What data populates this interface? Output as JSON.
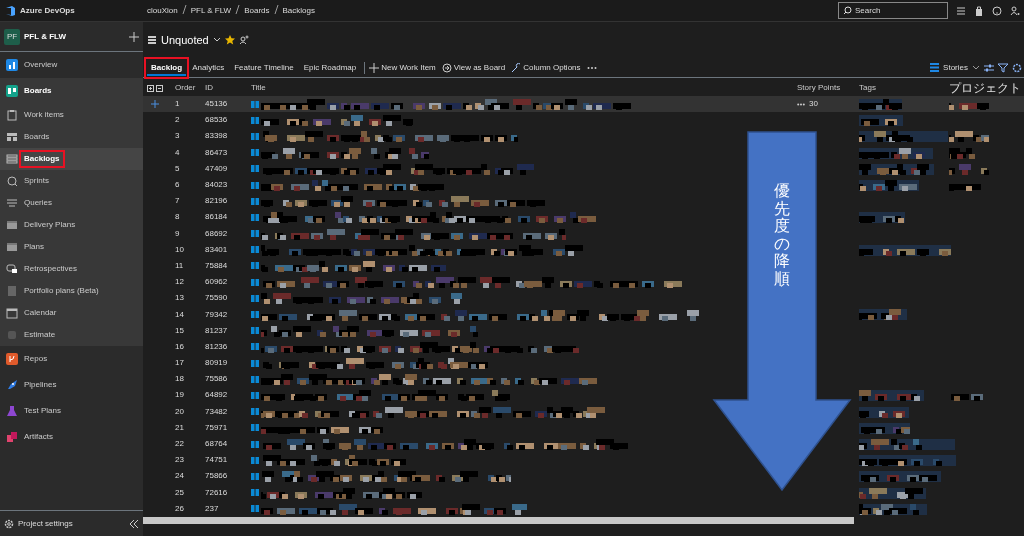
{
  "topbar": {
    "brand": "Azure DevOps",
    "breadcrumbs": [
      "clouXion",
      "PFL & FLW",
      "Boards",
      "Backlogs"
    ],
    "search": {
      "placeholder": "Search"
    }
  },
  "sidebar": {
    "project": {
      "initials": "PF",
      "name": "PFL & FLW"
    },
    "items": [
      {
        "label": "Overview",
        "kind": "section",
        "selected": false,
        "highlighted": false
      },
      {
        "label": "Boards",
        "kind": "section",
        "selected": false,
        "highlighted": false,
        "expanded": true,
        "children": [
          {
            "label": "Work items",
            "kind": "page",
            "selected": false,
            "highlighted": false
          },
          {
            "label": "Boards",
            "kind": "page",
            "selected": false,
            "highlighted": false
          },
          {
            "label": "Backlogs",
            "kind": "page",
            "selected": true,
            "highlighted": true
          },
          {
            "label": "Sprints",
            "kind": "page",
            "selected": false,
            "highlighted": false
          },
          {
            "label": "Queries",
            "kind": "page",
            "selected": false,
            "highlighted": false
          },
          {
            "label": "Delivery Plans",
            "kind": "page",
            "selected": false,
            "highlighted": false
          },
          {
            "label": "Plans",
            "kind": "page",
            "selected": false,
            "highlighted": false
          },
          {
            "label": "Retrospectives",
            "kind": "page",
            "selected": false,
            "highlighted": false
          },
          {
            "label": "Portfolio plans (Beta)",
            "kind": "page",
            "selected": false,
            "highlighted": false
          },
          {
            "label": "Calendar",
            "kind": "page",
            "selected": false,
            "highlighted": false
          },
          {
            "label": "Estimate",
            "kind": "page",
            "selected": false,
            "highlighted": false
          }
        ]
      },
      {
        "label": "Repos",
        "kind": "section",
        "selected": false,
        "highlighted": false
      },
      {
        "label": "Pipelines",
        "kind": "section",
        "selected": false,
        "highlighted": false
      },
      {
        "label": "Test Plans",
        "kind": "section",
        "selected": false,
        "highlighted": false
      },
      {
        "label": "Artifacts",
        "kind": "section",
        "selected": false,
        "highlighted": false
      }
    ],
    "settings": "Project settings"
  },
  "header": {
    "title": "Unquoted"
  },
  "tabs": [
    {
      "label": "Backlog",
      "selected": true,
      "highlighted": true
    },
    {
      "label": "Analytics",
      "selected": false,
      "highlighted": false
    },
    {
      "label": "Feature Timeline",
      "selected": false,
      "highlighted": false
    },
    {
      "label": "Epic Roadmap",
      "selected": false,
      "highlighted": false
    }
  ],
  "actions": [
    {
      "label": "New Work Item"
    },
    {
      "label": "View as Board"
    },
    {
      "label": "Column Options"
    }
  ],
  "level_picker": "Stories",
  "table": {
    "columns": [
      "Order",
      "ID",
      "Title",
      "Story Points",
      "Tags",
      "プロジェクト"
    ],
    "rows": [
      {
        "order": "1",
        "id": "45136",
        "points": "30",
        "selected": true,
        "tags": true,
        "project": true
      },
      {
        "order": "2",
        "id": "68536",
        "selected": false,
        "tags": true,
        "project": false
      },
      {
        "order": "3",
        "id": "83398",
        "selected": false,
        "tags": true,
        "project": true
      },
      {
        "order": "4",
        "id": "86473",
        "selected": false,
        "tags": true,
        "project": true
      },
      {
        "order": "5",
        "id": "47409",
        "selected": false,
        "tags": true,
        "project": true
      },
      {
        "order": "6",
        "id": "84023",
        "selected": false,
        "tags": true,
        "project": true
      },
      {
        "order": "7",
        "id": "82196",
        "selected": false,
        "tags": false,
        "project": false
      },
      {
        "order": "8",
        "id": "86184",
        "selected": false,
        "tags": true,
        "project": false
      },
      {
        "order": "9",
        "id": "68692",
        "selected": false,
        "tags": false,
        "project": false
      },
      {
        "order": "10",
        "id": "83401",
        "selected": false,
        "tags": true,
        "project": false
      },
      {
        "order": "11",
        "id": "75884",
        "selected": false,
        "tags": false,
        "project": false
      },
      {
        "order": "12",
        "id": "60962",
        "selected": false,
        "tags": false,
        "project": false
      },
      {
        "order": "13",
        "id": "75590",
        "selected": false,
        "tags": false,
        "project": false
      },
      {
        "order": "14",
        "id": "79342",
        "selected": false,
        "tags": true,
        "project": false
      },
      {
        "order": "15",
        "id": "81237",
        "selected": false,
        "tags": false,
        "project": false
      },
      {
        "order": "16",
        "id": "81236",
        "selected": false,
        "tags": false,
        "project": false
      },
      {
        "order": "17",
        "id": "80919",
        "selected": false,
        "tags": false,
        "project": false
      },
      {
        "order": "18",
        "id": "75586",
        "selected": false,
        "tags": false,
        "project": false
      },
      {
        "order": "19",
        "id": "64892",
        "selected": false,
        "tags": true,
        "project": true
      },
      {
        "order": "20",
        "id": "73482",
        "selected": false,
        "tags": true,
        "project": false
      },
      {
        "order": "21",
        "id": "75971",
        "selected": false,
        "tags": true,
        "project": false
      },
      {
        "order": "22",
        "id": "68764",
        "selected": false,
        "tags": true,
        "project": false
      },
      {
        "order": "23",
        "id": "74751",
        "selected": false,
        "tags": true,
        "project": false
      },
      {
        "order": "24",
        "id": "75866",
        "selected": false,
        "tags": true,
        "project": false
      },
      {
        "order": "25",
        "id": "72616",
        "selected": false,
        "tags": true,
        "project": false
      },
      {
        "order": "26",
        "id": "237",
        "selected": false,
        "tags": true,
        "project": false
      }
    ]
  },
  "overlay": {
    "text": "優先度の降順"
  }
}
